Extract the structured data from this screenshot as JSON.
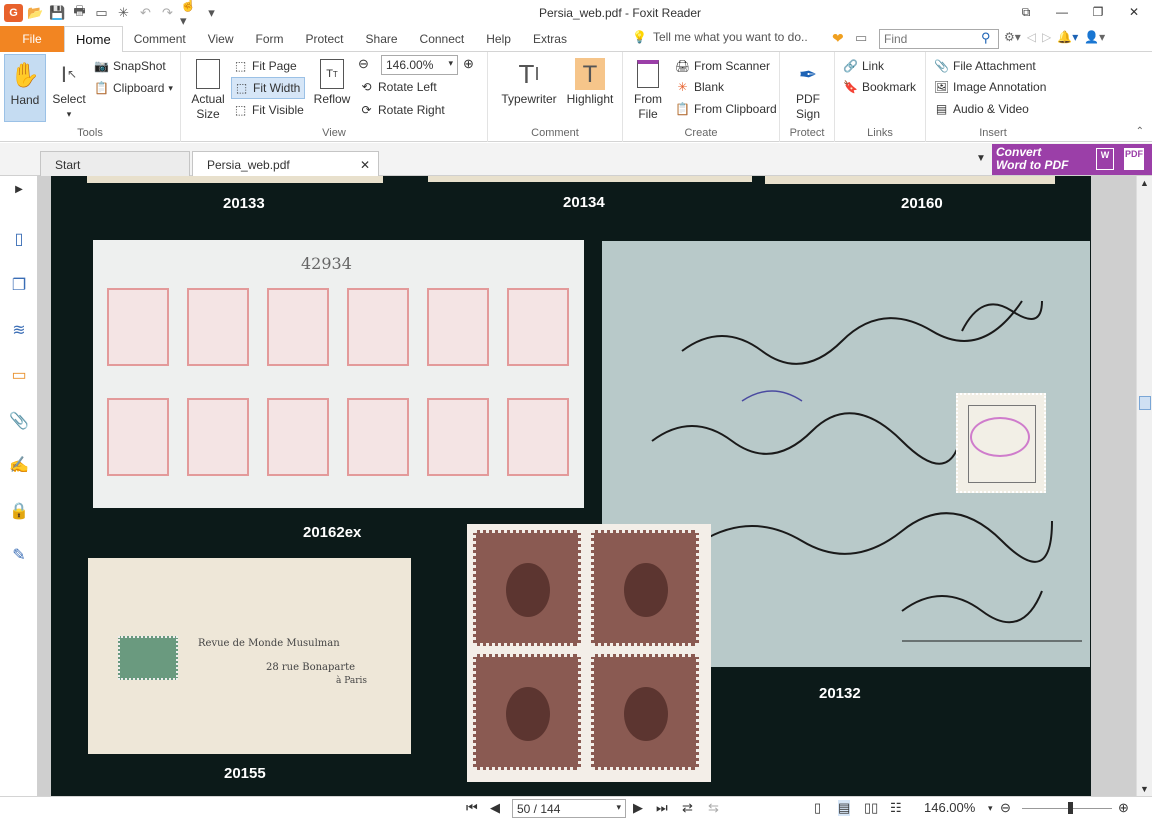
{
  "app": {
    "title": "Persia_web.pdf - Foxit Reader"
  },
  "tabs": {
    "file": "File",
    "items": [
      "Home",
      "Comment",
      "View",
      "Form",
      "Protect",
      "Share",
      "Connect",
      "Help",
      "Extras"
    ],
    "tell_me": "Tell me what you want to do..",
    "find_placeholder": "Find"
  },
  "ribbon": {
    "tools": {
      "hand": "Hand",
      "select": "Select",
      "snapshot": "SnapShot",
      "clipboard": "Clipboard",
      "label": "Tools"
    },
    "view": {
      "actual": "Actual",
      "size": "Size",
      "fit_page": "Fit Page",
      "fit_width": "Fit Width",
      "fit_visible": "Fit Visible",
      "reflow": "Reflow",
      "zoom": "146.00%",
      "rotate_left": "Rotate Left",
      "rotate_right": "Rotate Right",
      "label": "View"
    },
    "comment": {
      "typewriter": "Typewriter",
      "highlight": "Highlight",
      "label": "Comment"
    },
    "create": {
      "from": "From",
      "file": "File",
      "from_scanner": "From Scanner",
      "blank": "Blank",
      "from_clipboard": "From Clipboard",
      "label": "Create"
    },
    "protect": {
      "pdf": "PDF",
      "sign": "Sign",
      "label": "Protect"
    },
    "links": {
      "link": "Link",
      "bookmark": "Bookmark",
      "label": "Links"
    },
    "insert": {
      "file_attachment": "File Attachment",
      "image_annotation": "Image Annotation",
      "audio_video": "Audio & Video",
      "label": "Insert"
    }
  },
  "doc_tabs": {
    "start": "Start",
    "current": "Persia_web.pdf"
  },
  "convert": {
    "line1": "Convert",
    "line2": "Word to PDF"
  },
  "page": {
    "lots": [
      "20133",
      "20134",
      "20160",
      "20162ex",
      "20132",
      "20155"
    ],
    "sheet_number": "42934",
    "cover_text": {
      "l1": "Revue de Monde Musulman",
      "l2": "28 rue Bonaparte",
      "l3": "à Paris"
    }
  },
  "status": {
    "page": "50 / 144",
    "zoom": "146.00%"
  }
}
